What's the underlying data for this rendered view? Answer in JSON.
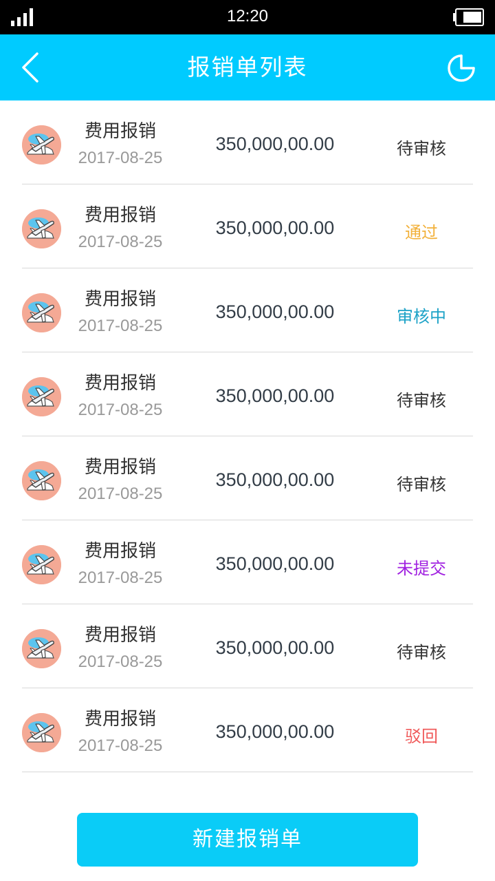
{
  "status_bar": {
    "time": "12:20"
  },
  "header": {
    "title": "报销单列表"
  },
  "items": [
    {
      "name": "费用报销",
      "date": "2017-08-25",
      "amount": "350,000,00.00",
      "status": "待审核",
      "status_color": "#333333"
    },
    {
      "name": "费用报销",
      "date": "2017-08-25",
      "amount": "350,000,00.00",
      "status": "通过",
      "status_color": "#f2b13b"
    },
    {
      "name": "费用报销",
      "date": "2017-08-25",
      "amount": "350,000,00.00",
      "status": "审核中",
      "status_color": "#1ca2c7"
    },
    {
      "name": "费用报销",
      "date": "2017-08-25",
      "amount": "350,000,00.00",
      "status": "待审核",
      "status_color": "#333333"
    },
    {
      "name": "费用报销",
      "date": "2017-08-25",
      "amount": "350,000,00.00",
      "status": "待审核",
      "status_color": "#333333"
    },
    {
      "name": "费用报销",
      "date": "2017-08-25",
      "amount": "350,000,00.00",
      "status": "未提交",
      "status_color": "#a020e0"
    },
    {
      "name": "费用报销",
      "date": "2017-08-25",
      "amount": "350,000,00.00",
      "status": "待审核",
      "status_color": "#333333"
    },
    {
      "name": "费用报销",
      "date": "2017-08-25",
      "amount": "350,000,00.00",
      "status": "驳回",
      "status_color": "#f05a5a"
    }
  ],
  "footer": {
    "new_button_label": "新建报销单"
  },
  "icons": {
    "back": "chevron-left-icon",
    "history": "clock-icon",
    "item": "airplane-icon",
    "signal": "signal-icon",
    "battery": "battery-icon"
  },
  "colors": {
    "primary": "#00cbff",
    "button": "#0accf7",
    "avatar_bg": "#f4a995"
  }
}
